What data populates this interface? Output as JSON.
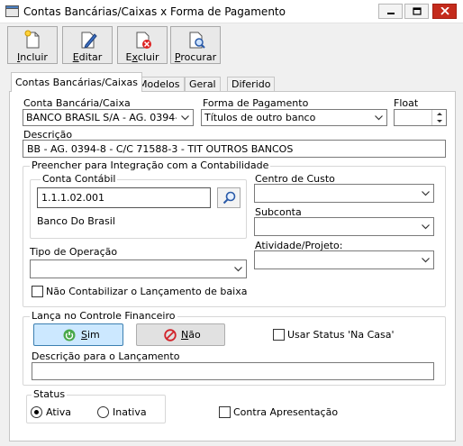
{
  "window": {
    "title": "Contas Bancárias/Caixas x Forma de Pagamento"
  },
  "toolbar": {
    "incluir": {
      "label_u": "I",
      "label_rest": "ncluir"
    },
    "editar": {
      "label_u": "E",
      "label_rest": "ditar"
    },
    "excluir": {
      "label_pre": "E",
      "label_u": "x",
      "label_rest": "cluir"
    },
    "procurar": {
      "label_u": "P",
      "label_rest": "rocurar"
    }
  },
  "tabs": [
    "Contas Bancárias/Caixas",
    "Modelos",
    "Geral",
    "Diferido"
  ],
  "form": {
    "conta_label": "Conta Bancária/Caixa",
    "conta_value": "BANCO BRASIL S/A - AG. 0394-8 -",
    "forma_label": "Forma de Pagamento",
    "forma_value": "Títulos de outro banco",
    "float_label": "Float",
    "float_value": "",
    "descricao_label": "Descrição",
    "descricao_value": "BB - AG. 0394-8 - C/C 71588-3 - TIT OUTROS BANCOS"
  },
  "contabilidade": {
    "group_title": "Preencher para Integração com a Contabilidade",
    "conta_contabil_title": "Conta Contábil",
    "conta_contabil_value": "1.1.1.02.001",
    "conta_contabil_desc": "Banco Do Brasil",
    "centro_custo_label": "Centro de Custo",
    "subconta_label": "Subconta",
    "tipo_operacao_label": "Tipo de Operação",
    "atividade_label": "Atividade/Projeto:",
    "nao_contabilizar_label": "Não Contabilizar o Lançamento de baixa"
  },
  "financeiro": {
    "group_title": "Lança no Controle Financeiro",
    "sim_u": "S",
    "sim_rest": "im",
    "nao_u": "N",
    "nao_rest": "ão",
    "usar_status_label": "Usar Status 'Na Casa'",
    "descricao_lancamento_label": "Descrição para o Lançamento",
    "descricao_lancamento_value": ""
  },
  "status": {
    "group_title": "Status",
    "ativa_label": "Ativa",
    "inativa_label": "Inativa",
    "selected": "Ativa",
    "contra_apresentacao_label": "Contra Apresentação"
  }
}
